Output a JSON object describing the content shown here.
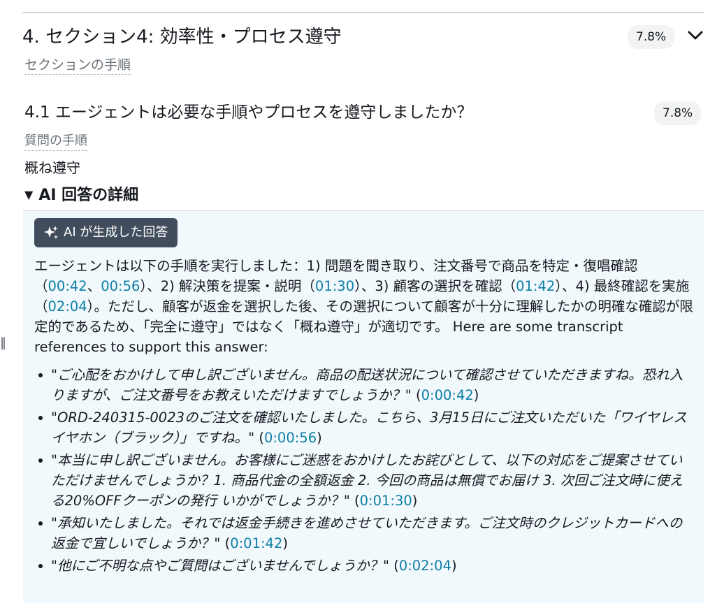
{
  "section": {
    "title": "4. セクション4: 効率性・プロセス遵守",
    "subtitle": "セクションの手順",
    "score": "7.8%"
  },
  "question": {
    "title": "4.1 エージェントは必要な手順やプロセスを遵守しましたか？",
    "subtitle": "質問の手順",
    "score": "7.8%",
    "answer": "概ね遵守"
  },
  "details": {
    "summary": "AI 回答の詳細",
    "chip_label": "AI が生成した回答",
    "explanation": {
      "p1": "エージェントは以下の手順を実行しました：1) 問題を聞き取り、注文番号で商品を特定・復唱確認（",
      "t1": "00:42",
      "sep1": "、",
      "t2": "00:56",
      "p2": "）、2) 解決策を提案・説明（",
      "t3": "01:30",
      "p3": "）、3) 顧客の選択を確認（",
      "t4": "01:42",
      "p4": "）、4) 最終確認を実施（",
      "t5": "02:04",
      "p5": "）。ただし、顧客が返金を選択した後、その選択について顧客が十分に理解したかの明確な確認が限定的であるため、「完全に遵守」ではなく「概ね遵守」が適切です。 Here are some transcript references to support this answer:"
    },
    "references": [
      {
        "quote": "\"ご心配をおかけして申し訳ございません。商品の配送状況について確認させていただきますね。恐れ入りますが、ご注文番号をお教えいただけますでしょうか？\"",
        "time": "0:00:42"
      },
      {
        "quote": "\"ORD-240315-0023のご注文を確認いたしました。こちら、3月15日にご注文いただいた「ワイヤレスイヤホン（ブラック）」ですね。\"",
        "time": "0:00:56"
      },
      {
        "quote": "\"本当に申し訳ございません。お客様にご迷惑をおかけしたお詫びとして、以下の対応をご提案させていただけませんでしょうか？1. 商品代金の全額返金 2. 今回の商品は無償でお届け 3. 次回ご注文時に使える20%OFFクーポンの発行 いかがでしょうか？\"",
        "time": "0:01:30"
      },
      {
        "quote": "\"承知いたしました。それでは返金手続きを進めさせていただきます。ご注文時のクレジットカードへの返金で宜しいでしょうか？\"",
        "time": "0:01:42"
      },
      {
        "quote": "\"他にご不明な点やご質問はございませんでしょうか？\"",
        "time": "0:02:04"
      }
    ]
  },
  "icons": {
    "chevron": "chevron-down-icon",
    "sparkle": "sparkle-icon",
    "triangle": "triangle-down-icon",
    "handle": "drag-handle-icon"
  },
  "colors": {
    "link": "#0f7ea6",
    "chip_bg": "#414d5c",
    "panel_bg": "#f1f9fd",
    "badge_bg": "#f2f3f3"
  }
}
